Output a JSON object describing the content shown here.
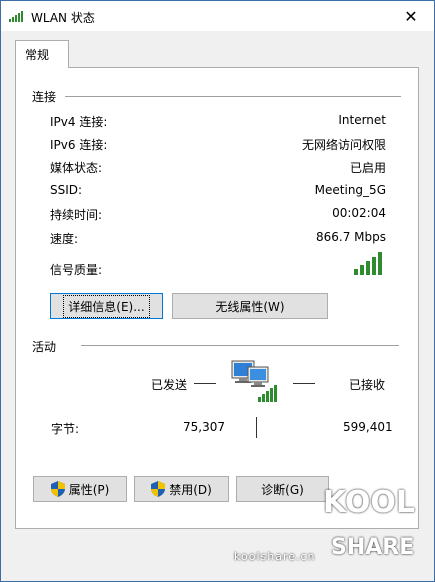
{
  "window": {
    "title": "WLAN 状态",
    "close_label": "✕"
  },
  "tabs": [
    {
      "label": "常规"
    }
  ],
  "connection": {
    "header": "连接",
    "rows": [
      {
        "label": "IPv4 连接:",
        "value": "Internet"
      },
      {
        "label": "IPv6 连接:",
        "value": "无网络访问权限"
      },
      {
        "label": "媒体状态:",
        "value": "已启用"
      },
      {
        "label": "SSID:",
        "value": "Meeting_5G"
      },
      {
        "label": "持续时间:",
        "value": "00:02:04"
      },
      {
        "label": "速度:",
        "value": "866.7 Mbps"
      },
      {
        "label": "信号质量:",
        "value": ""
      }
    ],
    "signal_bars_filled": 5,
    "signal_bars_total": 5,
    "details_button": "详细信息(E)...",
    "wireless_props_button": "无线属性(W)"
  },
  "activity": {
    "header": "活动",
    "sent_label": "已发送",
    "received_label": "已接收",
    "bytes_label": "字节:",
    "bytes_sent": "75,307",
    "bytes_received": "599,401"
  },
  "buttons": {
    "properties": "属性(P)",
    "disable": "禁用(D)",
    "diagnose": "诊断(G)"
  },
  "watermark": {
    "logo_top": "KOOL",
    "logo_bottom": "SHARE",
    "url": "koolshare.cn"
  },
  "colors": {
    "signal_green": "#2e8b2e",
    "focus_blue": "#0078d7",
    "shield_blue": "#1e5fb4",
    "shield_yellow": "#f2c200"
  }
}
